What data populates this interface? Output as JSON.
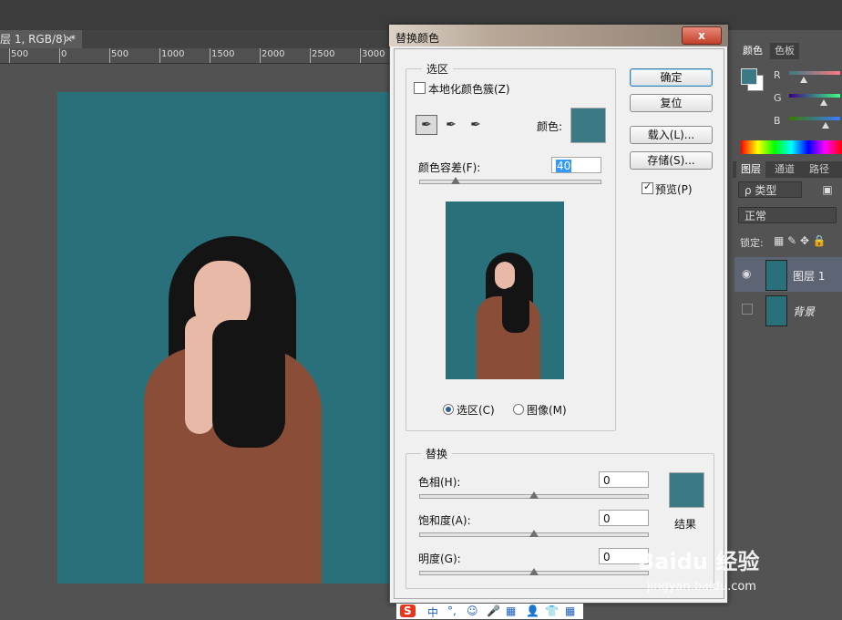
{
  "document": {
    "tab_title": "层 1, RGB/8) *",
    "close_glyph": "×",
    "ruler_labels": [
      "500",
      "0",
      "500",
      "1000",
      "1500",
      "2000",
      "2500",
      "3000"
    ]
  },
  "panels": {
    "color_tabs": [
      "颜色",
      "色板"
    ],
    "channel_labels": [
      "R",
      "G",
      "B"
    ],
    "layers_tabs": [
      "图层",
      "通道",
      "路径"
    ],
    "filter_kind": "ρ 类型",
    "blend_mode": "正常",
    "lock_label": "锁定:",
    "layers": [
      {
        "name": "图层 1",
        "selected": true,
        "visible": true
      },
      {
        "name": "背景",
        "selected": false,
        "visible": false
      }
    ]
  },
  "dialog": {
    "title": "替换颜色",
    "close_label": "x",
    "selection_group_label": "选区",
    "localized_clusters_label": "本地化颜色簇(Z)",
    "localized_clusters_checked": false,
    "color_label": "颜色:",
    "fuzziness_label": "颜色容差(F):",
    "fuzziness_value": "40",
    "fuzziness_fraction": 0.2,
    "radio_selection_label": "选区(C)",
    "radio_image_label": "图像(M)",
    "selected_radio": "selection",
    "buttons": {
      "ok": "确定",
      "reset": "复位",
      "load": "载入(L)...",
      "save": "存储(S)..."
    },
    "preview_label": "预览(P)",
    "preview_checked": true,
    "replace_group_label": "替换",
    "hue_label": "色相(H):",
    "hue_value": "0",
    "saturation_label": "饱和度(A):",
    "saturation_value": "0",
    "lightness_label": "明度(G):",
    "lightness_value": "0",
    "result_label": "结果",
    "sample_color": "#3b7a84",
    "result_color": "#3b7a84"
  },
  "ime": {
    "logo": "S",
    "items": [
      "中",
      "°,",
      "☺",
      "🎤",
      "▦",
      "👤",
      "👕",
      "▦"
    ]
  },
  "watermark": {
    "brand": "Baidu 经验",
    "url": "jingyan.baidu.com"
  }
}
